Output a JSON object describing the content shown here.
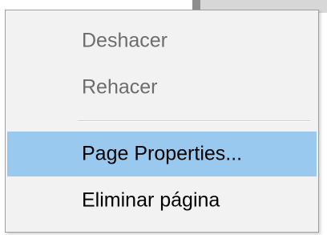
{
  "context_menu": {
    "items": [
      {
        "label": "Deshacer",
        "enabled": false
      },
      {
        "label": "Rehacer",
        "enabled": false
      },
      {
        "label": "Page Properties...",
        "enabled": true,
        "highlighted": true
      },
      {
        "label": "Eliminar página",
        "enabled": true
      }
    ]
  },
  "colors": {
    "highlight": "#99c9ef",
    "menu_background": "#f2f2f2",
    "disabled_text": "#6d6d6d",
    "border": "#a0a0a0"
  }
}
